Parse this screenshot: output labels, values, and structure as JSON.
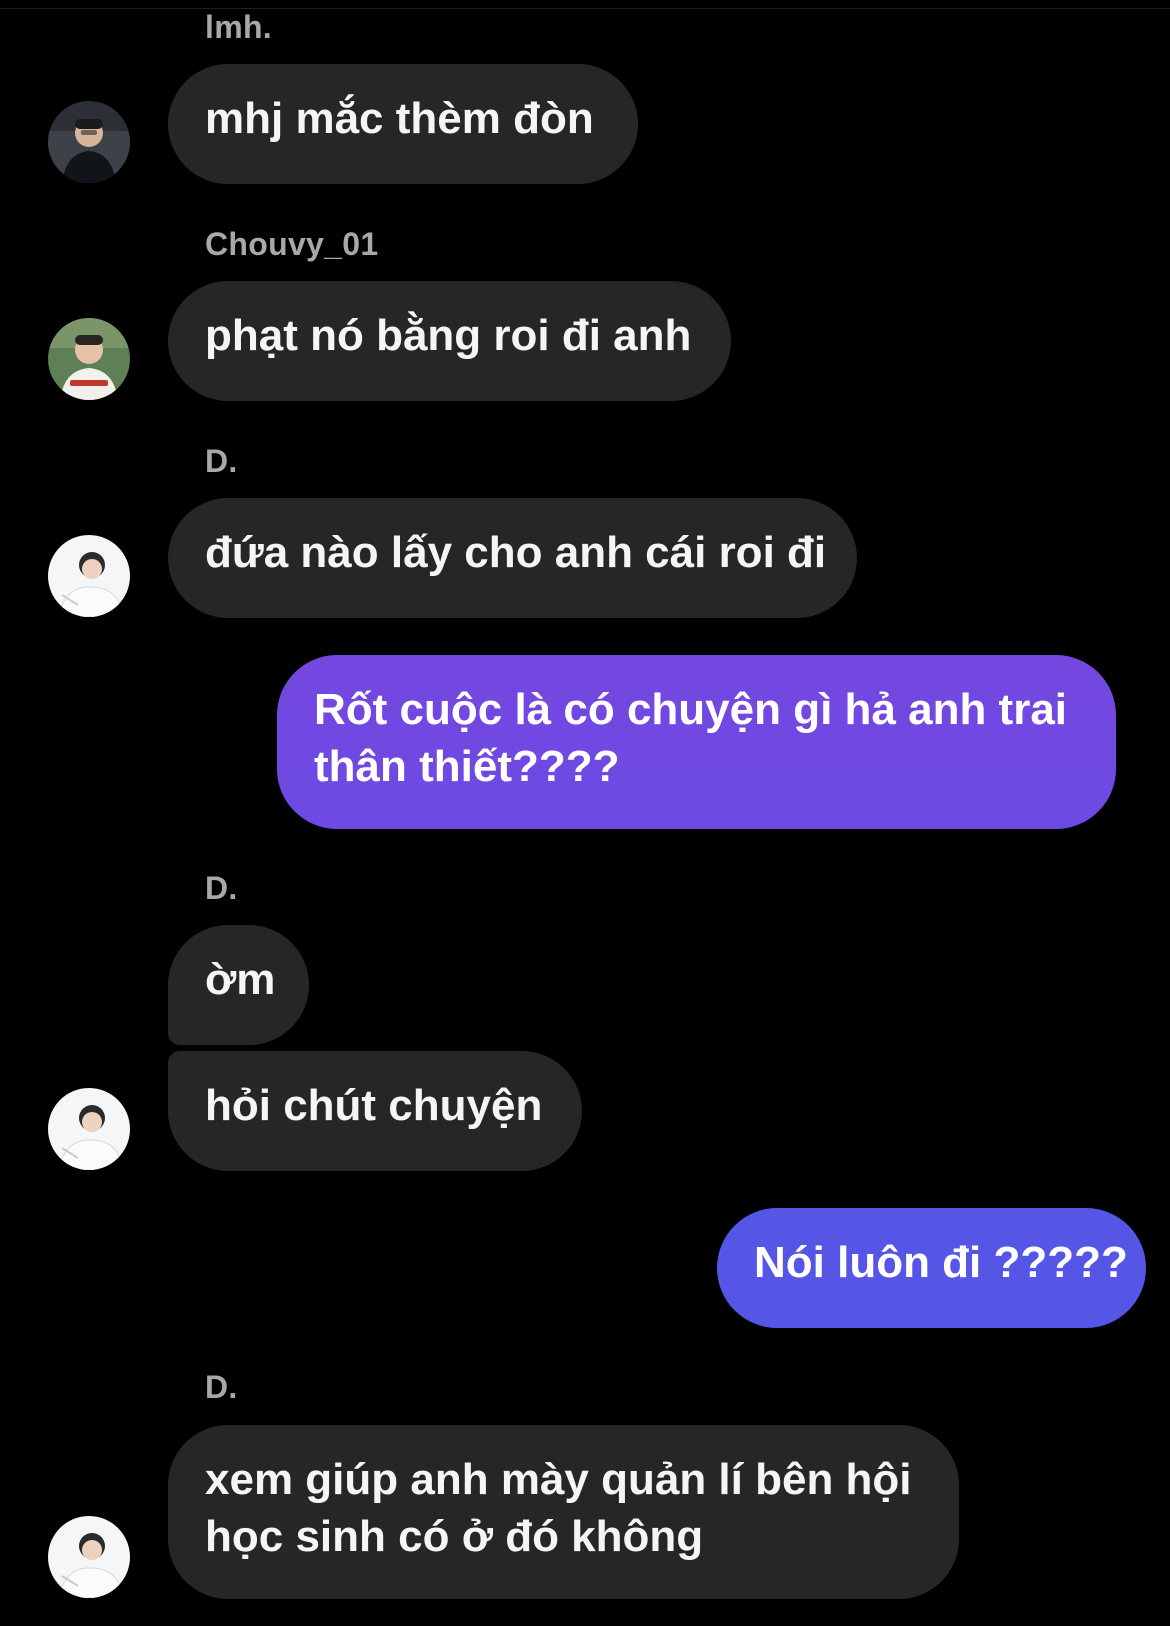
{
  "colors": {
    "background": "#000000",
    "incoming_bubble": "#262626",
    "outgoing_gradient_top": "#7447e0",
    "outgoing_gradient_bottom": "#5556e6",
    "sender_text": "#a8a8a8"
  },
  "messages": [
    {
      "sender": "lmh.",
      "text": "mhj mắc thèm đòn",
      "avatar": "avatar-lmh-photo"
    },
    {
      "sender": "Chouvy_01",
      "text": "phạt nó bằng roi đi anh",
      "avatar": "avatar-chouvy-photo"
    },
    {
      "sender": "D.",
      "text": "đứa nào lấy cho anh cái roi đi",
      "avatar": "avatar-d-photo"
    },
    {
      "outgoing_line1": "Rốt cuộc là có chuyện gì hả anh trai",
      "outgoing_line2": "thân thiết????"
    },
    {
      "sender": "D.",
      "text1": "ờm",
      "text2": "hỏi chút chuyện",
      "avatar": "avatar-d-photo"
    },
    {
      "outgoing": "Nói luôn đi ?????"
    },
    {
      "sender": "D.",
      "line1": "xem giúp anh mày quản lí bên hội",
      "line2": "học sinh có ở đó không",
      "avatar": "avatar-d-photo"
    }
  ]
}
